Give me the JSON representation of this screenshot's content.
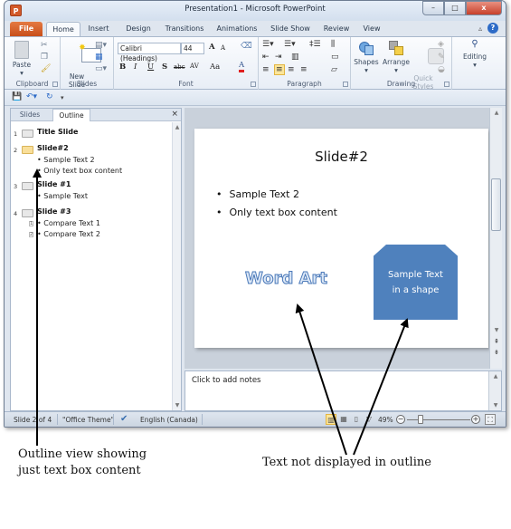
{
  "window": {
    "title": "Presentation1 - Microsoft PowerPoint",
    "app_icon_letter": "P",
    "controls": {
      "minimize": "–",
      "restore": "□",
      "close": "x"
    }
  },
  "ribbon_tabs": [
    "File",
    "Home",
    "Insert",
    "Design",
    "Transitions",
    "Animations",
    "Slide Show",
    "Review",
    "View"
  ],
  "ribbon_active_tab": "Home",
  "ribbon": {
    "clipboard": {
      "label": "Clipboard",
      "paste": "Paste"
    },
    "slides": {
      "label": "Slides",
      "new_slide": "New\nSlide"
    },
    "font": {
      "label": "Font",
      "font_name": "Calibri (Headings)",
      "font_size": "44",
      "bold": "B",
      "italic": "I",
      "underline": "U",
      "shadow": "S",
      "strike": "abc",
      "spacing": "AV",
      "case": "Aa",
      "color": "A",
      "grow": "A",
      "shrink": "A"
    },
    "paragraph": {
      "label": "Paragraph"
    },
    "drawing": {
      "label": "Drawing",
      "shapes": "Shapes",
      "arrange": "Arrange",
      "quick_styles": "Quick\nStyles"
    },
    "editing": {
      "label": "Editing"
    }
  },
  "left_pane": {
    "tabs": [
      "Slides",
      "Outline"
    ],
    "active_tab": "Outline",
    "close": "×",
    "outline": [
      {
        "num": "1",
        "title": "Title Slide",
        "selected": false,
        "bullets": []
      },
      {
        "num": "2",
        "title": "Slide#2",
        "selected": true,
        "bullets": [
          "Sample Text 2",
          "Only text box content"
        ]
      },
      {
        "num": "3",
        "title": "Slide  #1",
        "selected": false,
        "bullets": [
          "Sample Text"
        ]
      },
      {
        "num": "4",
        "title": "Slide  #3",
        "selected": false,
        "bullets": [
          "Compare Text 1",
          "Compare Text 2"
        ],
        "levels": [
          "1",
          "2"
        ]
      }
    ]
  },
  "slide": {
    "title": "Slide#2",
    "bullets": [
      "Sample Text  2",
      "Only text box content"
    ],
    "wordart": "Word Art",
    "shape_text_line1": "Sample Text",
    "shape_text_line2": "in a shape",
    "shape_color": "#4f81bd"
  },
  "notes": {
    "placeholder": "Click to add notes"
  },
  "status_bar": {
    "slide_pos": "Slide 2 of 4",
    "theme": "\"Office Theme\"",
    "language": "English (Canada)",
    "zoom": "49%",
    "zoom_fraction": 0.49
  },
  "annotations": {
    "left_line1": "Outline view showing",
    "left_line2": "just text box content",
    "right": "Text not displayed in outline"
  }
}
